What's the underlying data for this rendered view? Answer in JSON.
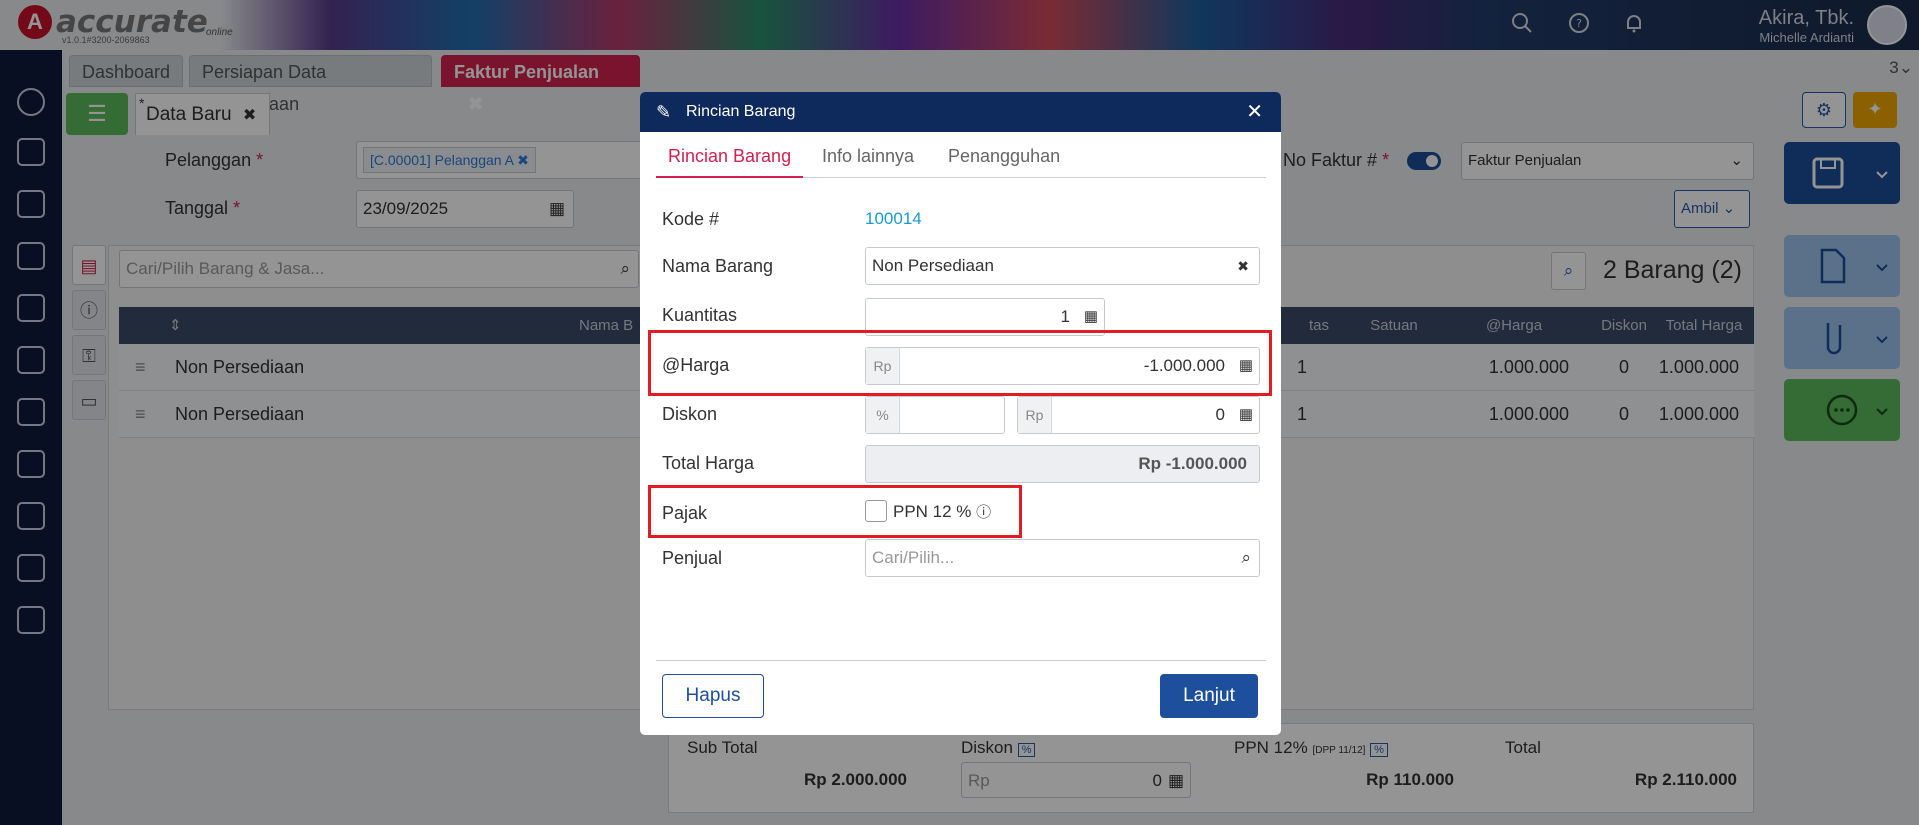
{
  "app": {
    "logo_text": "accurate",
    "logo_sub": "online",
    "version": "v1.0.1#3200-2069863",
    "user_name": "Akira, Tbk.",
    "user_sub": "Michelle Ardianti",
    "tab_count": "3"
  },
  "tabs": [
    {
      "label": "Dashboard"
    },
    {
      "label": "Persiapan Data Perusahaan"
    },
    {
      "label": "Faktur Penjualan"
    }
  ],
  "subtab": {
    "label": "Data Baru",
    "star": "*"
  },
  "form": {
    "pelanggan_label": "Pelanggan",
    "pelanggan_value": "[C.00001] Pelanggan A",
    "tanggal_label": "Tanggal",
    "tanggal_value": "23/09/2025",
    "no_faktur_label": "No Faktur #",
    "faktur_select": "Faktur Penjualan",
    "ambil_label": "Ambil",
    "search_placeholder": "Cari/Pilih Barang & Jasa...",
    "barang_count": "2 Barang (2)",
    "req_star": "*"
  },
  "table": {
    "headers": [
      "Nama B",
      "tas",
      "Satuan",
      "@Harga",
      "Diskon",
      "Total Harga"
    ],
    "rows": [
      {
        "name": "Non Persediaan",
        "qty": "1",
        "harga": "1.000.000",
        "diskon": "0",
        "total": "1.000.000"
      },
      {
        "name": "Non Persediaan",
        "qty": "1",
        "harga": "1.000.000",
        "diskon": "0",
        "total": "1.000.000"
      }
    ]
  },
  "summary": {
    "subtotal_label": "Sub Total",
    "subtotal_value": "Rp 2.000.000",
    "diskon_label": "Diskon",
    "diskon_value": "0",
    "ppn_label": "PPN 12%",
    "ppn_dpp": "[DPP 11/12]",
    "ppn_value": "Rp 110.000",
    "total_label": "Total",
    "total_value": "Rp 2.110.000",
    "pct": "%",
    "rp": "Rp"
  },
  "modal": {
    "title": "Rincian Barang",
    "tabs": [
      "Rincian Barang",
      "Info lainnya",
      "Penangguhan"
    ],
    "kode_label": "Kode #",
    "kode_value": "100014",
    "nama_label": "Nama Barang",
    "nama_value": "Non Persediaan",
    "kuantitas_label": "Kuantitas",
    "kuantitas_value": "1",
    "harga_label": "@Harga",
    "harga_prefix": "Rp",
    "harga_value": "-1.000.000",
    "diskon_label": "Diskon",
    "diskon_pct_prefix": "%",
    "diskon_rp_prefix": "Rp",
    "diskon_value": "0",
    "total_label": "Total Harga",
    "total_value": "Rp -1.000.000",
    "pajak_label": "Pajak",
    "ppn_option": "PPN 12 %",
    "ppn_checked": false,
    "penjual_label": "Penjual",
    "penjual_placeholder": "Cari/Pilih...",
    "hapus_label": "Hapus",
    "lanjut_label": "Lanjut"
  },
  "colors": {
    "accent": "#d3214f",
    "primary": "#1d4f9c",
    "highlight": "#e31b23",
    "header_bg": "#0e2a5c"
  }
}
